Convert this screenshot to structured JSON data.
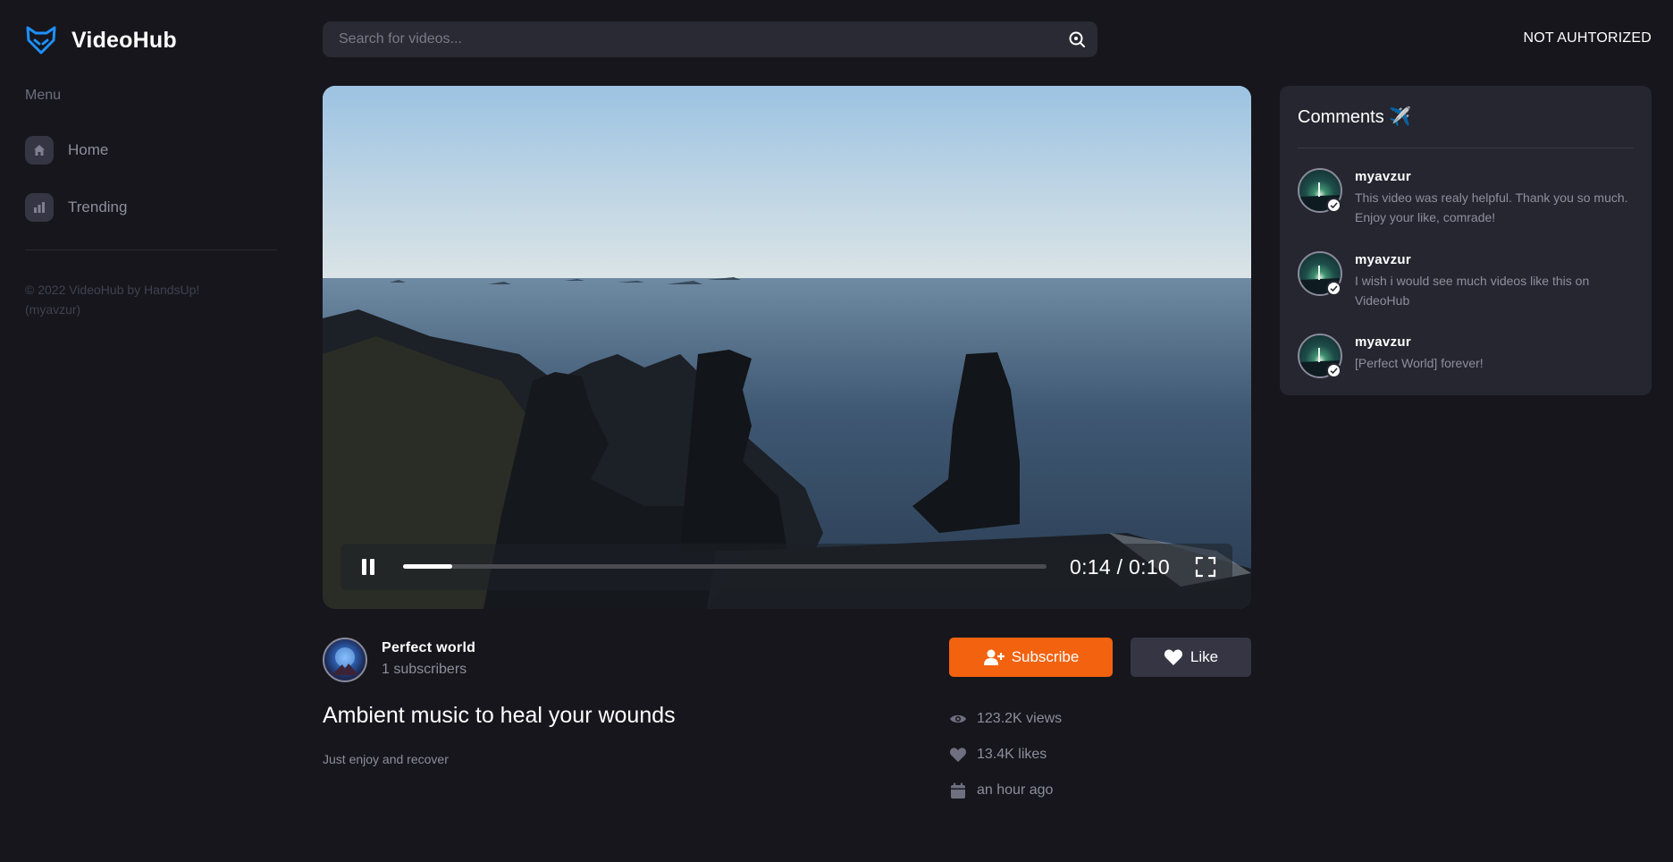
{
  "brand": {
    "name": "VideoHub"
  },
  "sidebar": {
    "menu_heading": "Menu",
    "items": [
      {
        "label": "Home",
        "icon": "home-icon"
      },
      {
        "label": "Trending",
        "icon": "bar-chart-icon"
      }
    ],
    "copyright": "© 2022 VideoHub by HandsUp! (myavzur)"
  },
  "search": {
    "placeholder": "Search for videos...",
    "value": ""
  },
  "header": {
    "auth_status": "NOT AUHTORIZED"
  },
  "player": {
    "timecode": "0:14 / 0:10",
    "progress_fraction": 0.076,
    "pause_label": "Pause",
    "fullscreen_label": "Fullscreen"
  },
  "channel": {
    "name": "Perfect world",
    "subscribers": "1 subscribers"
  },
  "video": {
    "title": "Ambient music to heal your wounds",
    "description": "Just enjoy and recover",
    "views": "123.2K views",
    "likes": "13.4K likes",
    "uploaded": "an hour ago"
  },
  "actions": {
    "subscribe_label": "Subscribe",
    "like_label": "Like"
  },
  "comments": {
    "title": "Comments ✈️",
    "items": [
      {
        "user": "myavzur",
        "text": "This video was realy helpful. Thank you so much. Enjoy your like, comrade!"
      },
      {
        "user": "myavzur",
        "text": "I wish i would see much videos like this on VideoHub"
      },
      {
        "user": "myavzur",
        "text": "[Perfect World] forever!"
      }
    ]
  },
  "colors": {
    "accent": "#f2620f",
    "brand_blue": "#1e90ff",
    "background": "#16161c",
    "panel": "#262631"
  }
}
